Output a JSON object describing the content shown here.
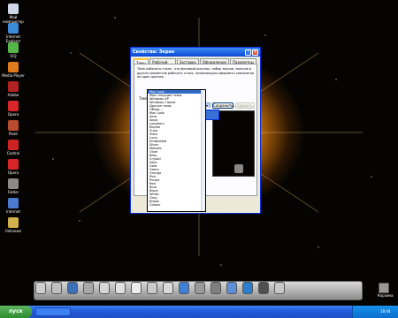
{
  "desktop": {
    "icons": [
      {
        "label": "Мой компьютер",
        "icon": "computer-icon",
        "color": "#cfd8e6"
      },
      {
        "label": "Internet Explorer",
        "icon": "internet-explorer-icon",
        "color": "#3b8ad8"
      },
      {
        "label": "ICQ",
        "icon": "icq-icon",
        "color": "#57b64a"
      },
      {
        "label": "Media Player",
        "icon": "media-player-icon",
        "color": "#e07a1f"
      },
      {
        "label": "Adobe",
        "icon": "adobe-icon",
        "color": "#b22222"
      },
      {
        "label": "Opera",
        "icon": "opera-icon",
        "color": "#d8252a"
      },
      {
        "label": "Paint",
        "icon": "paint-icon",
        "color": "#b84a2e"
      },
      {
        "label": "Control",
        "icon": "control-icon",
        "color": "#cc2222"
      },
      {
        "label": "Opera",
        "icon": "opera-icon",
        "color": "#d8252a"
      },
      {
        "label": "Folder",
        "icon": "folder-icon",
        "color": "#8a8a8a"
      },
      {
        "label": "Internet",
        "icon": "network-icon",
        "color": "#4b7ad1"
      },
      {
        "label": "Unknown",
        "icon": "app-icon",
        "color": "#d0b04a"
      }
    ]
  },
  "window": {
    "title": "Свойства: Экран",
    "tabs": [
      "Темы",
      "Рабочий стол",
      "Заставка",
      "Оформление",
      "Параметры"
    ],
    "active_tab": "Темы",
    "description": "Тема рабочего стола - это фоновый рисунок, набор звуков, значков и других элементов рабочего стола, позволяющих оформить компьютер на один щелчок.",
    "group_label": "Тема:",
    "theme_value": "Mac Look",
    "save_label": "Сохранить...",
    "delete_label": "Удалить"
  },
  "dropdown": {
    "items": [
      "Mac Look",
      "Мои текущие темы",
      "Windows XP",
      "Windows Classic",
      "Другие темы",
      "Обзор...",
      "Mac Look",
      "Aero",
      "Aqua",
      "Longhorn",
      "Royale",
      "Zune",
      "Vista",
      "Luna",
      "Embedded",
      "Silver",
      "Metallic",
      "Olive",
      "Bliss",
      "Crystal",
      "Dark",
      "Gold",
      "Green",
      "Orange",
      "Pink",
      "Purple",
      "Red",
      "Blue",
      "Black",
      "White",
      "Gray",
      "Brown",
      "Classic"
    ],
    "selected_index": 0
  },
  "dock": {
    "icons": [
      {
        "icon": "finder-icon",
        "color": "#cfcfcf"
      },
      {
        "icon": "photo-icon",
        "color": "#bfbfbf"
      },
      {
        "icon": "globe-icon",
        "color": "#3e6fb6"
      },
      {
        "icon": "mail-icon",
        "color": "#a9a9a9"
      },
      {
        "icon": "app-store-icon",
        "color": "#d6d6d6"
      },
      {
        "icon": "calendar-icon",
        "color": "#e0e0e0"
      },
      {
        "icon": "dictionary-icon",
        "color": "#ececec"
      },
      {
        "icon": "contacts-icon",
        "color": "#c9c9c9"
      },
      {
        "icon": "ical-icon",
        "color": "#d9d9d9"
      },
      {
        "icon": "itunes-icon",
        "color": "#3f7fd8"
      },
      {
        "icon": "camera-icon",
        "color": "#9a9a9a"
      },
      {
        "icon": "preferences-icon",
        "color": "#7f7f7f"
      },
      {
        "icon": "safari-icon",
        "color": "#5c8fd8"
      },
      {
        "icon": "cloud-icon",
        "color": "#2c7ed0"
      },
      {
        "icon": "music-icon",
        "color": "#4f4f4f"
      },
      {
        "icon": "movie-icon",
        "color": "#c8c8c8"
      }
    ],
    "trash_label": "Корзина"
  },
  "taskbar": {
    "start_label": "пуск",
    "clock": "18:44"
  }
}
